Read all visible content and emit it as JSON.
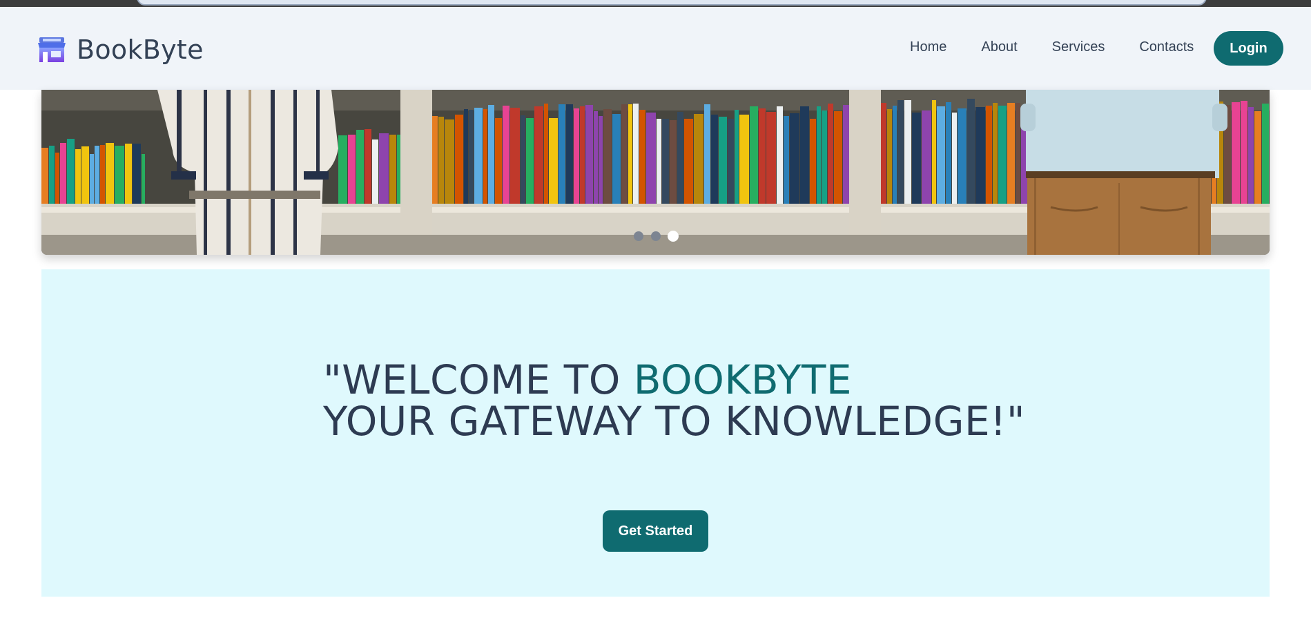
{
  "brand": {
    "name": "BookByte",
    "icon": "storefront-icon"
  },
  "nav": {
    "items": [
      {
        "label": "Home"
      },
      {
        "label": "About"
      },
      {
        "label": "Services"
      },
      {
        "label": "Contacts"
      }
    ],
    "login_label": "Login"
  },
  "hero": {
    "image": "bookshelf-photo",
    "carousel_count": 3,
    "active_slide": 3
  },
  "welcome": {
    "line1_prefix": "\"WELCOME TO ",
    "line1_brand": "BOOKBYTE",
    "line2": "YOUR GATEWAY TO KNOWLEDGE!\"",
    "cta_label": "Get Started"
  },
  "colors": {
    "primary": "#0f6b70",
    "nav_background": "#f0f4f9",
    "welcome_background": "#dff9fd",
    "heading_text": "#2d3b52"
  }
}
